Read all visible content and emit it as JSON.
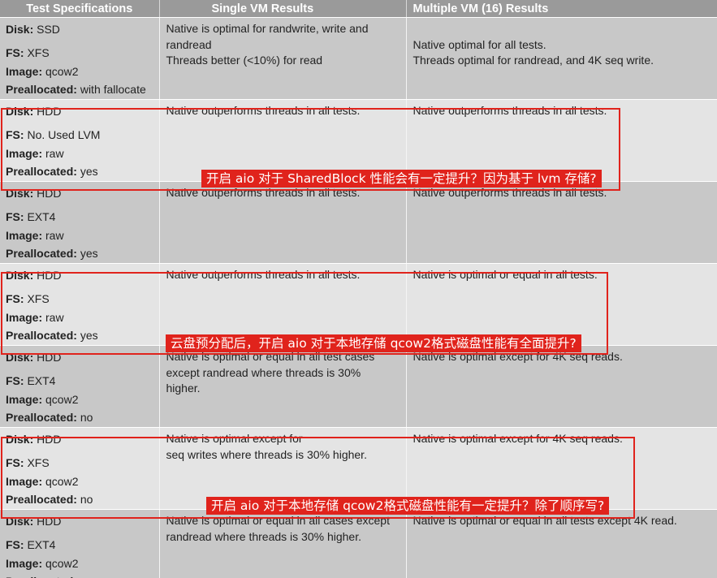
{
  "header": {
    "col1": "Test Specifications",
    "col2": "Single VM Results",
    "col3": "Multiple VM (16) Results"
  },
  "rows": [
    {
      "disk": "SSD",
      "fs": "XFS",
      "image": "qcow2",
      "prealloc": "with fallocate",
      "single": [
        "Native is optimal for randwrite, write and",
        "randread",
        "Threads better (<10%) for read"
      ],
      "multi": [
        "",
        "Native optimal for all tests.",
        "Threads optimal for  randread, and 4K seq write."
      ]
    },
    {
      "disk": "HDD",
      "fs": "No. Used LVM",
      "image": "raw",
      "prealloc": "yes",
      "single": [
        "Native outperforms threads in all tests."
      ],
      "multi": [
        "Native outperforms threads in all tests."
      ]
    },
    {
      "disk": "HDD",
      "fs": "EXT4",
      "image": "raw",
      "prealloc": "yes",
      "single": [
        "Native outperforms threads in all tests."
      ],
      "multi": [
        "Native outperforms threads in all tests."
      ]
    },
    {
      "disk": "HDD",
      "fs": "XFS",
      "image": "raw",
      "prealloc": "yes",
      "single": [
        "Native outperforms threads in all tests."
      ],
      "multi": [
        "Native is optimal or equal in all tests."
      ]
    },
    {
      "disk": "HDD",
      "fs": "EXT4",
      "image": "qcow2",
      "prealloc": "no",
      "single": [
        "Native is optimal or equal in all test cases",
        "except randread where threads is 30%",
        "higher."
      ],
      "multi": [
        "Native is optimal except for 4K seq reads."
      ]
    },
    {
      "disk": "HDD",
      "fs": "XFS",
      "image": "qcow2",
      "prealloc": "no",
      "single": [
        "Native is optimal except for",
        "seq writes where threads is 30% higher."
      ],
      "multi": [
        "Native is optimal except for 4K seq reads."
      ]
    },
    {
      "disk": "HDD",
      "fs": "EXT4",
      "image": "qcow2",
      "prealloc": "",
      "single": [
        "Native is optimal or equal in all cases except",
        "randread where threads is 30% higher."
      ],
      "multi": [
        "Native is optimal or equal in all tests except 4K read."
      ]
    }
  ],
  "labels": {
    "disk": "Disk:",
    "fs": "FS:",
    "image": "Image:",
    "prealloc": "Preallocated:"
  },
  "annotations": [
    "开启 aio 对于 SharedBlock 性能会有一定提升？因为基于 lvm 存储?",
    "云盘预分配后，开启 aio 对于本地存储 qcow2格式磁盘性能有全面提升?",
    "开启 aio 对于本地存储 qcow2格式磁盘性能有一定提升？除了顺序写?"
  ],
  "colors": {
    "header_bg": "#9a9a9a",
    "row_odd": "#c8c8c8",
    "row_even": "#e4e4e4",
    "annotation_red": "#e0231c"
  }
}
